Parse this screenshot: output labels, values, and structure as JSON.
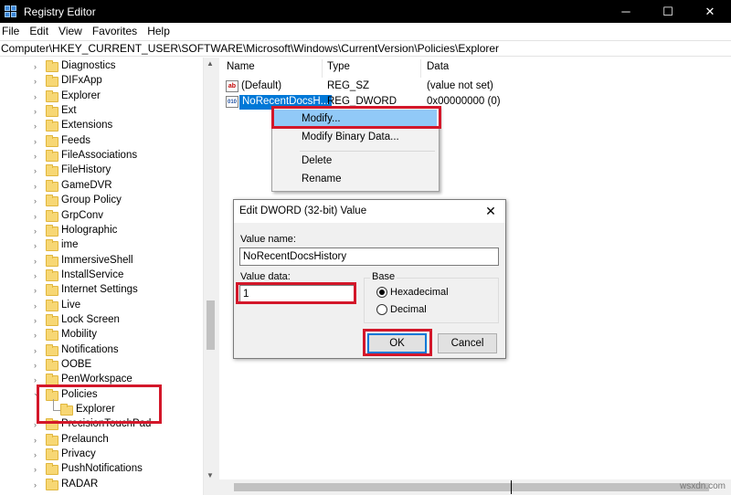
{
  "window": {
    "title": "Registry Editor",
    "minimize_glyph": "─",
    "maximize_glyph": "☐",
    "close_glyph": "✕"
  },
  "menu": [
    {
      "label": "File"
    },
    {
      "label": "Edit"
    },
    {
      "label": "View"
    },
    {
      "label": "Favorites"
    },
    {
      "label": "Help"
    }
  ],
  "address": "Computer\\HKEY_CURRENT_USER\\SOFTWARE\\Microsoft\\Windows\\CurrentVersion\\Policies\\Explorer",
  "tree": {
    "items": [
      {
        "label": "Diagnostics"
      },
      {
        "label": "DIFxApp"
      },
      {
        "label": "Explorer"
      },
      {
        "label": "Ext"
      },
      {
        "label": "Extensions"
      },
      {
        "label": "Feeds"
      },
      {
        "label": "FileAssociations"
      },
      {
        "label": "FileHistory"
      },
      {
        "label": "GameDVR"
      },
      {
        "label": "Group Policy"
      },
      {
        "label": "GrpConv"
      },
      {
        "label": "Holographic"
      },
      {
        "label": "ime"
      },
      {
        "label": "ImmersiveShell"
      },
      {
        "label": "InstallService"
      },
      {
        "label": "Internet Settings"
      },
      {
        "label": "Live"
      },
      {
        "label": "Lock Screen"
      },
      {
        "label": "Mobility"
      },
      {
        "label": "Notifications"
      },
      {
        "label": "OOBE"
      },
      {
        "label": "PenWorkspace"
      },
      {
        "label": "Policies"
      },
      {
        "label": "Explorer"
      },
      {
        "label": "PrecisionTouchPad"
      },
      {
        "label": "Prelaunch"
      },
      {
        "label": "Privacy"
      },
      {
        "label": "PushNotifications"
      },
      {
        "label": "RADAR"
      }
    ]
  },
  "list": {
    "columns": {
      "name": "Name",
      "type": "Type",
      "data": "Data"
    },
    "rows": [
      {
        "icon": "ab",
        "name": "(Default)",
        "type": "REG_SZ",
        "data": "(value not set)"
      },
      {
        "icon": "010",
        "name": "NoRecentDocsH...",
        "type": "REG_DWORD",
        "data": "0x00000000 (0)"
      }
    ]
  },
  "context_menu": {
    "items": [
      {
        "label": "Modify..."
      },
      {
        "label": "Modify Binary Data..."
      },
      {
        "label": "Delete"
      },
      {
        "label": "Rename"
      }
    ]
  },
  "dialog": {
    "title": "Edit DWORD (32-bit) Value",
    "value_name_label": "Value name:",
    "value_name": "NoRecentDocsHistory",
    "value_data_label": "Value data:",
    "value_data": "1",
    "base_label": "Base",
    "base_options": [
      {
        "label": "Hexadecimal",
        "checked": true
      },
      {
        "label": "Decimal",
        "checked": false
      }
    ],
    "ok_label": "OK",
    "cancel_label": "Cancel"
  },
  "watermark": "wsxdn.com",
  "colors": {
    "annotation": "#d3172a",
    "selection": "#0078d7",
    "menu_highlight": "#91c9f7"
  }
}
